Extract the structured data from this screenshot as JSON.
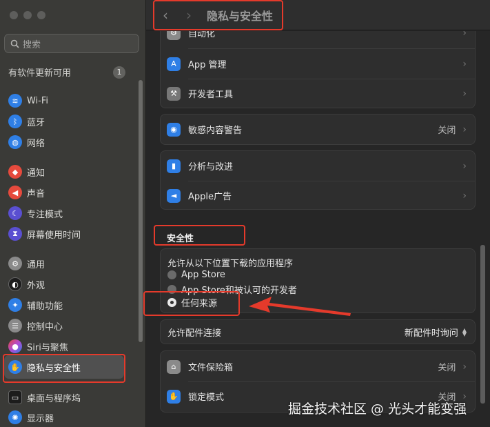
{
  "sidebar": {
    "search_placeholder": "搜索",
    "updates_label": "有软件更新可用",
    "updates_count": "1",
    "items": [
      {
        "label": "Wi-Fi",
        "icon": "wifi-icon",
        "color": "#2f7fe6"
      },
      {
        "label": "蓝牙",
        "icon": "bluetooth-icon",
        "color": "#2f7fe6"
      },
      {
        "label": "网络",
        "icon": "globe-icon",
        "color": "#2f7fe6"
      },
      {
        "label": "通知",
        "icon": "bell-icon",
        "color": "#e64a3d"
      },
      {
        "label": "声音",
        "icon": "speaker-icon",
        "color": "#e64a3d"
      },
      {
        "label": "专注模式",
        "icon": "moon-icon",
        "color": "#5a4fd1"
      },
      {
        "label": "屏幕使用时间",
        "icon": "hourglass-icon",
        "color": "#5a4fd1"
      },
      {
        "label": "通用",
        "icon": "gear-icon",
        "color": "#8a8a8a"
      },
      {
        "label": "外观",
        "icon": "appearance-icon",
        "color": "#1c1c1c"
      },
      {
        "label": "辅助功能",
        "icon": "accessibility-icon",
        "color": "#2f7fe6"
      },
      {
        "label": "控制中心",
        "icon": "control-center-icon",
        "color": "#8a8a8a"
      },
      {
        "label": "Siri与聚焦",
        "icon": "siri-icon",
        "color": "#b04bd6"
      },
      {
        "label": "隐私与安全性",
        "icon": "hand-icon",
        "color": "#2f7fe6"
      },
      {
        "label": "桌面与程序坞",
        "icon": "dock-icon",
        "color": "#1c1c1c"
      },
      {
        "label": "显示器",
        "icon": "display-icon",
        "color": "#2f7fe6"
      }
    ]
  },
  "header": {
    "title": "隐私与安全性"
  },
  "main": {
    "group1": [
      {
        "label": "自动化",
        "icon": "automation-icon",
        "color": "#8a8a8a"
      },
      {
        "label": "App 管理",
        "icon": "app-store-icon",
        "color": "#2f7fe6"
      },
      {
        "label": "开发者工具",
        "icon": "hammer-icon",
        "color": "#777777"
      }
    ],
    "sensitive": {
      "label": "敏感内容警告",
      "value": "关闭",
      "icon": "eye-icon",
      "color": "#2f7fe6"
    },
    "group3": [
      {
        "label": "分析与改进",
        "icon": "chart-icon",
        "color": "#2f7fe6"
      },
      {
        "label": "Apple广告",
        "icon": "megaphone-icon",
        "color": "#2f7fe6"
      }
    ],
    "security_title": "安全性",
    "allow_label": "允许从以下位置下载的应用程序",
    "radio_options": [
      "App Store",
      "App Store和被认可的开发者",
      "任何来源"
    ],
    "accessory_label": "允许配件连接",
    "accessory_value": "新配件时询问",
    "filevault": {
      "label": "文件保险箱",
      "value": "关闭",
      "icon": "house-icon",
      "color": "#8a8a8a"
    },
    "lockdown": {
      "label": "锁定模式",
      "value": "关闭",
      "icon": "hand-icon",
      "color": "#2f7fe6"
    }
  },
  "watermark": "掘金技术社区 @ 光头才能变强"
}
